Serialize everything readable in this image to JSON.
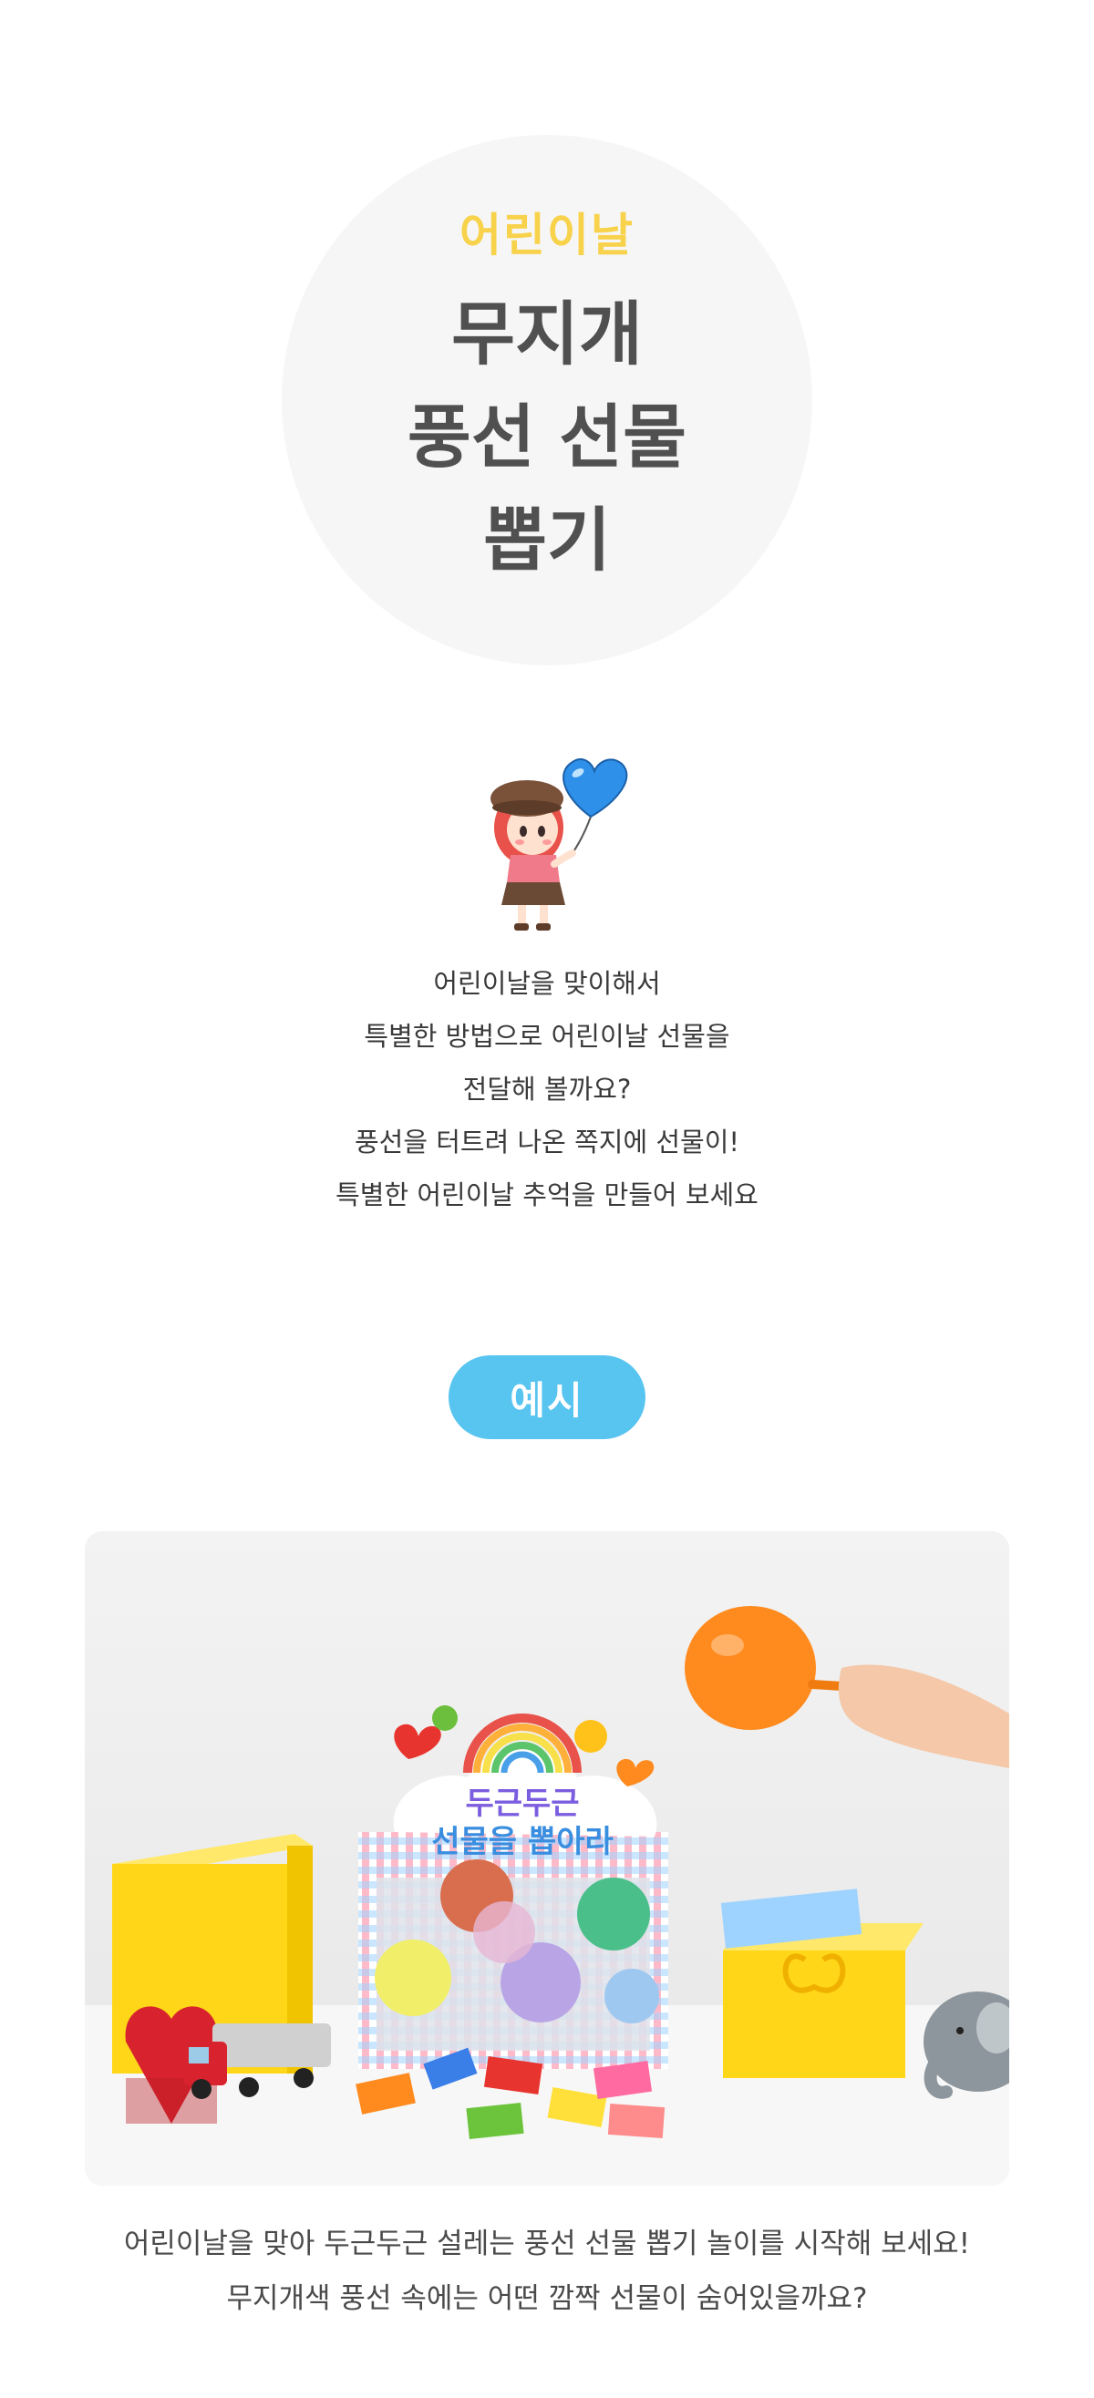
{
  "hero": {
    "subtitle": "어린이날",
    "title_lines": [
      "무지개",
      "풍선 선물",
      "뽑기"
    ]
  },
  "intro": {
    "lines": [
      "어린이날을 맞이해서",
      "특별한 방법으로 어린이날 선물을",
      "전달해 볼까요?",
      "풍선을 터트려 나온 쪽지에 선물이!",
      "특별한 어린이날 추억을 만들어 보세요"
    ]
  },
  "example": {
    "label": "예시",
    "accent_color": "#58c4f0"
  },
  "photo": {
    "sign_line1": "두근두근",
    "sign_line2": "선물을 뽑아라"
  },
  "caption": {
    "lines": [
      "어린이날을 맞아 두근두근 설레는 풍선 선물 뽑기 놀이를 시작해 보세요!",
      "무지개색 풍선 속에는 어떤 깜짝 선물이 숨어있을까요?"
    ]
  },
  "colors": {
    "subtitle": "#f7d24a",
    "title": "#505050",
    "circle": "#f6f6f6"
  }
}
